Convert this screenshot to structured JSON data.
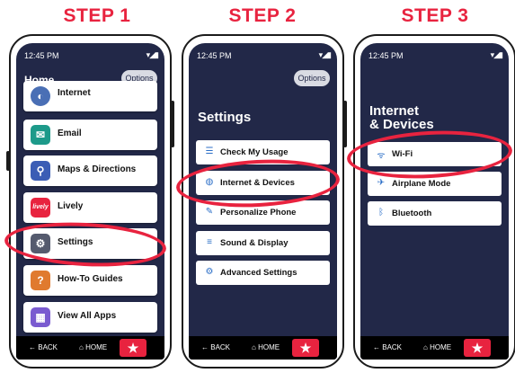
{
  "steps": [
    "STEP 1",
    "STEP 2",
    "STEP 3"
  ],
  "status": {
    "time": "12:45 PM",
    "icons": "▾◢▮"
  },
  "nav": {
    "back": "BACK",
    "home": "HOME",
    "back_glyph": "←",
    "home_glyph": "⌂",
    "star_glyph": "★"
  },
  "phone1": {
    "title": "Home",
    "options_label": "Options",
    "items": [
      {
        "label": "Internet",
        "icon": "globe-icon",
        "color": "#4a6fb5",
        "glyph": "◐"
      },
      {
        "label": "Email",
        "icon": "email-icon",
        "color": "#1d9a8a",
        "glyph": "✉"
      },
      {
        "label": "Maps & Directions",
        "icon": "map-pin-icon",
        "color": "#3b5db5",
        "glyph": "⚲"
      },
      {
        "label": "Lively",
        "icon": "lively-logo-icon",
        "color": "#e8233f",
        "glyph": "lively"
      },
      {
        "label": "Settings",
        "icon": "gear-icon",
        "color": "#555b6e",
        "glyph": "⚙"
      },
      {
        "label": "How-To Guides",
        "icon": "question-icon",
        "color": "#e07a2f",
        "glyph": "?"
      },
      {
        "label": "View All Apps",
        "icon": "grid-icon",
        "color": "#7a5bd0",
        "glyph": "▦"
      }
    ]
  },
  "phone2": {
    "title": "Settings",
    "options_label": "Options",
    "items": [
      {
        "label": "Check My Usage",
        "icon": "list-icon",
        "glyph": "☰"
      },
      {
        "label": "Internet & Devices",
        "icon": "globe-icon",
        "glyph": "◍"
      },
      {
        "label": "Personalize Phone",
        "icon": "brush-icon",
        "glyph": "✎"
      },
      {
        "label": "Sound & Display",
        "icon": "sliders-icon",
        "glyph": "≡"
      },
      {
        "label": "Advanced Settings",
        "icon": "gear-icon",
        "glyph": "⚙"
      }
    ]
  },
  "phone3": {
    "title_line1": "Internet",
    "title_line2": "& Devices",
    "items": [
      {
        "label": "Wi-Fi",
        "icon": "wifi-icon",
        "glyph": "ᯤ"
      },
      {
        "label": "Airplane Mode",
        "icon": "airplane-icon",
        "glyph": "✈"
      },
      {
        "label": "Bluetooth",
        "icon": "bluetooth-icon",
        "glyph": "ᛒ"
      }
    ]
  },
  "colors": {
    "accent": "#e8233f",
    "screen_bg": "#222848"
  }
}
